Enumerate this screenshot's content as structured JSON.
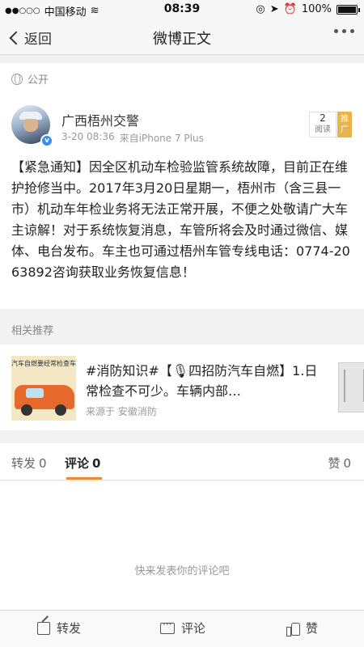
{
  "statusbar": {
    "carrier": "中国移动",
    "time": "08:39",
    "battery": "100%"
  },
  "nav": {
    "back_label": "返回",
    "title": "微博正文"
  },
  "post": {
    "visibility": "公开",
    "author": "广西梧州交警",
    "date": "3-20 08:36",
    "source": "来自iPhone 7 Plus",
    "read_count": "2",
    "read_label": "阅读",
    "promote_label": "推广",
    "content": "【紧急通知】因全区机动车检验监管系统故障，目前正在维护抢修当中。2017年3月20日星期一，梧州市（含三县一市）机动车年检业务将无法正常开展，不便之处敬请广大车主谅解！对于系统恢复消息，车管所将会及时通过微信、媒体、电台发布。车主也可通过梧州车管专线电话：0774-2063892咨询获取业务恢复信息！"
  },
  "related": {
    "section_title": "相关推荐",
    "thumb_banner": "汽车自燃要经常检查车",
    "text": "#消防知识#【🎙四招防汽车自燃】1.日常检查不可少。车辆内部…",
    "source": "来源于 安徽消防"
  },
  "tabs": {
    "repost_label": "转发",
    "repost_count": "0",
    "comment_label": "评论",
    "comment_count": "0",
    "like_label": "赞",
    "like_count": "0"
  },
  "comments": {
    "empty_placeholder": "快来发表你的评论吧"
  },
  "toolbar": {
    "repost": "转发",
    "comment": "评论",
    "like": "赞"
  },
  "colors": {
    "accent": "#f08a24",
    "verified": "#3b8ee8",
    "promo": "#e9b34d"
  }
}
